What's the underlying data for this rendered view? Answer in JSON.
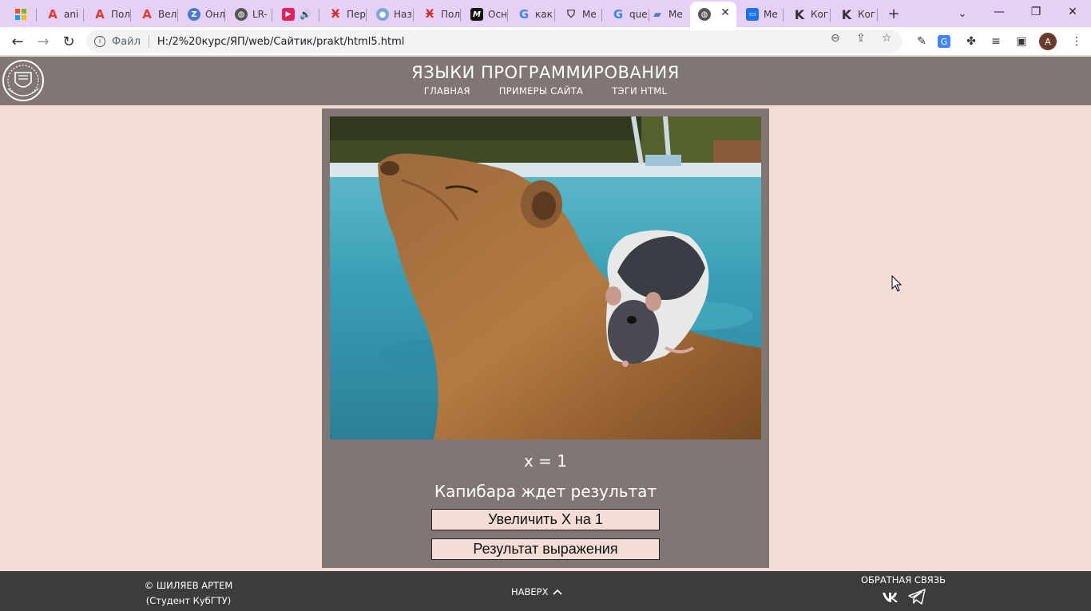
{
  "browser": {
    "tabs": [
      {
        "label": "",
        "icon": "windows-apps-icon"
      },
      {
        "label": "ani",
        "icon": "a-red-icon"
      },
      {
        "label": "Пол",
        "icon": "a-red-icon"
      },
      {
        "label": "Вел",
        "icon": "a-red-icon"
      },
      {
        "label": "Онл",
        "icon": "z-blue-icon"
      },
      {
        "label": "LR-",
        "icon": "globe-icon"
      },
      {
        "label": "",
        "icon": "play-red-icon"
      },
      {
        "label": "Пер",
        "icon": "figure-red-icon"
      },
      {
        "label": "Наз",
        "icon": "person-icon"
      },
      {
        "label": "Пол",
        "icon": "figure-red-icon"
      },
      {
        "label": "Осн",
        "icon": "m-black-icon"
      },
      {
        "label": "как",
        "icon": "google-icon"
      },
      {
        "label": "Me",
        "icon": "shield-icon"
      },
      {
        "label": "que",
        "icon": "google-icon"
      },
      {
        "label": "Me",
        "icon": "folder-icon"
      },
      {
        "label": "",
        "icon": "globe-icon",
        "active": true
      },
      {
        "label": "Me",
        "icon": "chat-icon"
      },
      {
        "label": "Ког",
        "icon": "k-icon"
      },
      {
        "label": "Ког",
        "icon": "k-icon"
      }
    ],
    "address": {
      "file_label": "Файл",
      "url": "H:/2%20курс/ЯП/web/Сайтик/prakt/html5.html"
    },
    "profile_initial": "A"
  },
  "site": {
    "title": "ЯЗЫКИ ПРОГРАММИРОВАНИЯ",
    "nav": [
      "ГЛАВНАЯ",
      "ПРИМЕРЫ САЙТА",
      "ТЭГИ HTML"
    ]
  },
  "main": {
    "x_display": "x = 1",
    "message": "Капибара ждет результат",
    "increase_button": "Увеличить X на 1",
    "result_button": "Результат выражения"
  },
  "footer": {
    "copyright": "© ШИЛЯЕВ АРТЕМ",
    "student": "(Студент КубГТУ)",
    "to_top": "НАВЕРХ",
    "feedback": "ОБРАТНАЯ СВЯЗЬ"
  }
}
